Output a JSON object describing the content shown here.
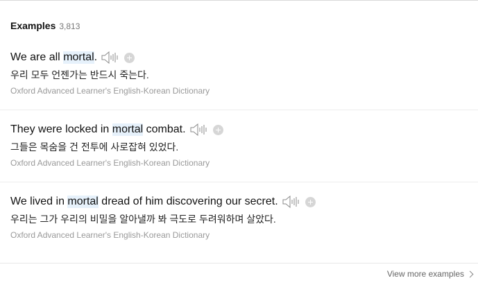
{
  "examples_section": {
    "title": "Examples",
    "count": "3,813"
  },
  "examples": [
    {
      "before": "We are all ",
      "highlight": "mortal",
      "after": ".",
      "translation": "우리 모두 언젠가는 반드시 죽는다.",
      "source": "Oxford Advanced Learner's English-Korean Dictionary"
    },
    {
      "before": "They were locked in ",
      "highlight": "mortal",
      "after": " combat.",
      "translation": "그들은 목숨을 건 전투에 사로잡혀 있었다.",
      "source": "Oxford Advanced Learner's English-Korean Dictionary"
    },
    {
      "before": "We lived in ",
      "highlight": "mortal",
      "after": " dread of him discovering our secret.",
      "translation": "우리는 그가 우리의 비밀을 알아낼까 봐 극도로 두려워하며 살았다.",
      "source": "Oxford Advanced Learner's English-Korean Dictionary"
    }
  ],
  "footer": {
    "view_more_label": "View more examples"
  },
  "icons": {
    "speaker": "speaker-icon",
    "add": "plus-circle-icon",
    "chevron": "chevron-right-icon"
  },
  "colors": {
    "highlight": "#e6f1fb",
    "source_text": "#999999"
  }
}
